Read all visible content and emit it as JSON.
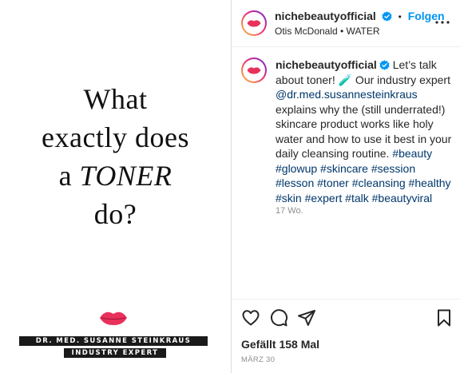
{
  "post_image": {
    "headline_lines": [
      "What",
      "exactly does"
    ],
    "headline_prefix": "a",
    "headline_emphasis": "TONER",
    "headline_last": "do?",
    "ribbon_name": "DR. MED. SUSANNE STEINKRAUS",
    "ribbon_role": "INDUSTRY EXPERT",
    "lips_icon": "lips-logo",
    "lips_color": "#e8315b"
  },
  "header": {
    "username": "nichebeautyofficial",
    "verified_icon": "verified-badge-icon",
    "separator": "•",
    "follow_label": "Folgen",
    "audio": "Otis McDonald • WATER",
    "more_icon": "more-options-icon"
  },
  "caption": {
    "username": "nichebeautyofficial",
    "text_intro": "Let’s talk about toner! 🧪 Our industry expert",
    "mention": "@dr.med.susannesteinkraus",
    "text_body": "explains why the (still underrated!) skincare product works like holy water and how to use it best in your daily cleansing routine.",
    "hashtags": "#beauty #glowup #skincare #session #lesson #toner #cleansing #healthy #skin #expert #talk #beautyviral",
    "time_ago": "17 Wo."
  },
  "actions": {
    "like_icon": "heart-icon",
    "comment_icon": "comment-icon",
    "share_icon": "share-icon",
    "save_icon": "bookmark-icon",
    "likes_text": "Gefällt 158 Mal",
    "date": "MÄRZ 30"
  },
  "colors": {
    "accent": "#0095f6",
    "link": "#00376b",
    "muted": "#8e8e8e",
    "text": "#262626"
  }
}
